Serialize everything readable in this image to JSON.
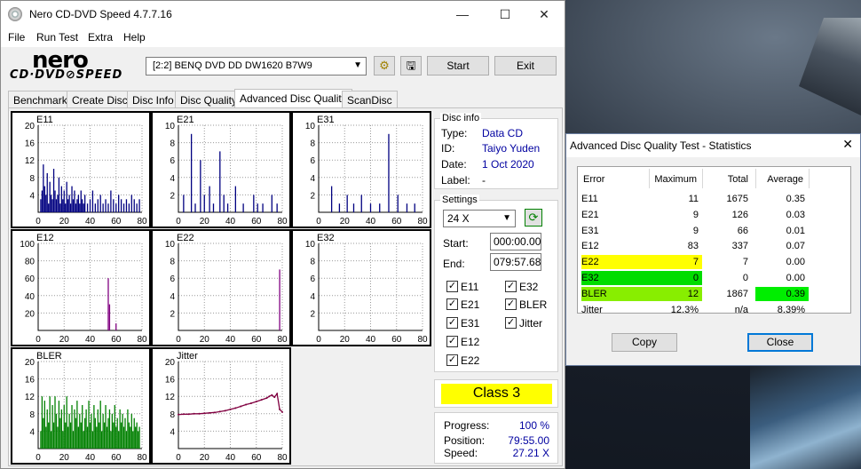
{
  "window": {
    "title": "Nero CD-DVD Speed 4.7.7.16",
    "minimize": "—",
    "maximize": "☐",
    "close": "✕"
  },
  "menu": [
    "File",
    "Run Test",
    "Extra",
    "Help"
  ],
  "logo": {
    "top": "nero",
    "bottom": "CD·DVD⊘SPEED"
  },
  "toolbar": {
    "drive": "[2:2]   BENQ DVD DD DW1620 B7W9",
    "start": "Start",
    "exit": "Exit"
  },
  "tabs": [
    "Benchmark",
    "Create Disc",
    "Disc Info",
    "Disc Quality",
    "Advanced Disc Quality",
    "ScanDisc"
  ],
  "active_tab": "Advanced Disc Quality",
  "disc_info": {
    "title": "Disc info",
    "type_label": "Type:",
    "type": "Data CD",
    "id_label": "ID:",
    "id": "Taiyo Yuden",
    "date_label": "Date:",
    "date": "1 Oct 2020",
    "label_label": "Label:",
    "label": "-"
  },
  "settings": {
    "title": "Settings",
    "speed": "24 X",
    "start_label": "Start:",
    "start": "000:00.00",
    "end_label": "End:",
    "end": "079:57.68",
    "checks": [
      {
        "label": "E11",
        "checked": true
      },
      {
        "label": "E32",
        "checked": true
      },
      {
        "label": "E21",
        "checked": true
      },
      {
        "label": "BLER",
        "checked": true
      },
      {
        "label": "E31",
        "checked": true
      },
      {
        "label": "Jitter",
        "checked": true
      },
      {
        "label": "E12",
        "checked": true
      },
      {
        "label": "E22",
        "checked": true
      }
    ]
  },
  "class": "Class 3",
  "progress": {
    "progress_label": "Progress:",
    "progress": "100 %",
    "position_label": "Position:",
    "position": "79:55.00",
    "speed_label": "Speed:",
    "speed": "27.21 X"
  },
  "chart_data": [
    {
      "type": "bar",
      "title": "E11",
      "color": "#000080",
      "ylim": [
        0,
        20
      ],
      "yticks": [
        4,
        8,
        12,
        16,
        20
      ],
      "xticks": [
        0,
        20,
        40,
        60,
        80
      ],
      "x": [
        2,
        3,
        4,
        5,
        6,
        7,
        8,
        9,
        10,
        11,
        12,
        13,
        14,
        15,
        16,
        17,
        18,
        19,
        20,
        21,
        22,
        23,
        24,
        25,
        26,
        27,
        28,
        29,
        30,
        31,
        32,
        33,
        34,
        35,
        36,
        38,
        40,
        42,
        44,
        46,
        48,
        50,
        52,
        54,
        56,
        58,
        60,
        62,
        64,
        66,
        68,
        70,
        72,
        74,
        76,
        78
      ],
      "values": [
        3,
        5,
        11,
        6,
        4,
        9,
        2,
        7,
        4,
        3,
        10,
        5,
        3,
        4,
        8,
        2,
        6,
        3,
        5,
        2,
        7,
        3,
        4,
        2,
        6,
        3,
        5,
        2,
        3,
        4,
        2,
        5,
        3,
        2,
        4,
        2,
        3,
        5,
        2,
        3,
        4,
        2,
        3,
        2,
        5,
        3,
        2,
        4,
        3,
        2,
        3,
        2,
        4,
        3,
        2,
        3
      ]
    },
    {
      "type": "bar",
      "title": "E21",
      "color": "#000080",
      "ylim": [
        0,
        10
      ],
      "yticks": [
        2,
        4,
        6,
        8,
        10
      ],
      "xticks": [
        0,
        20,
        40,
        60,
        80
      ],
      "x": [
        4,
        10,
        13,
        17,
        20,
        24,
        27,
        32,
        35,
        38,
        44,
        50,
        58,
        61,
        65,
        72,
        76
      ],
      "values": [
        2,
        9,
        1,
        6,
        2,
        3,
        1,
        7,
        2,
        1,
        3,
        1,
        2,
        1,
        1,
        2,
        1
      ]
    },
    {
      "type": "bar",
      "title": "E31",
      "color": "#000080",
      "ylim": [
        0,
        10
      ],
      "yticks": [
        2,
        4,
        6,
        8,
        10
      ],
      "xticks": [
        0,
        20,
        40,
        60,
        80
      ],
      "x": [
        10,
        16,
        22,
        27,
        33,
        40,
        47,
        54,
        61,
        68,
        74
      ],
      "values": [
        3,
        1,
        2,
        1,
        2,
        1,
        1,
        9,
        2,
        1,
        1
      ]
    },
    {
      "type": "bar",
      "title": "E12",
      "color": "#800080",
      "ylim": [
        0,
        100
      ],
      "yticks": [
        20,
        40,
        60,
        80,
        100
      ],
      "xticks": [
        0,
        20,
        40,
        60,
        80
      ],
      "x": [
        54,
        55,
        60
      ],
      "values": [
        60,
        30,
        8
      ]
    },
    {
      "type": "bar",
      "title": "E22",
      "color": "#800080",
      "ylim": [
        0,
        10
      ],
      "yticks": [
        2,
        4,
        6,
        8,
        10
      ],
      "xticks": [
        0,
        20,
        40,
        60,
        80
      ],
      "x": [
        78
      ],
      "values": [
        7
      ]
    },
    {
      "type": "bar",
      "title": "E32",
      "color": "#800080",
      "ylim": [
        0,
        10
      ],
      "yticks": [
        2,
        4,
        6,
        8,
        10
      ],
      "xticks": [
        0,
        20,
        40,
        60,
        80
      ],
      "x": [],
      "values": []
    },
    {
      "type": "bar",
      "title": "BLER",
      "color": "#008000",
      "ylim": [
        0,
        20
      ],
      "yticks": [
        4,
        8,
        12,
        16,
        20
      ],
      "xticks": [
        0,
        20,
        40,
        60,
        80
      ],
      "x": [
        2,
        3,
        4,
        5,
        6,
        7,
        8,
        9,
        10,
        11,
        12,
        13,
        14,
        15,
        16,
        17,
        18,
        19,
        20,
        21,
        22,
        23,
        24,
        25,
        26,
        27,
        28,
        29,
        30,
        31,
        32,
        33,
        34,
        35,
        36,
        37,
        38,
        39,
        40,
        41,
        42,
        43,
        44,
        45,
        46,
        47,
        48,
        49,
        50,
        51,
        52,
        53,
        54,
        55,
        56,
        57,
        58,
        59,
        60,
        61,
        62,
        63,
        64,
        65,
        66,
        67,
        68,
        69,
        70,
        71,
        72,
        73,
        74,
        75,
        76,
        77,
        78
      ],
      "values": [
        4,
        12,
        7,
        11,
        5,
        9,
        6,
        12,
        4,
        10,
        6,
        12,
        8,
        5,
        11,
        7,
        9,
        4,
        10,
        6,
        12,
        5,
        8,
        6,
        10,
        4,
        9,
        7,
        11,
        5,
        8,
        6,
        10,
        4,
        7,
        9,
        5,
        11,
        6,
        8,
        4,
        10,
        7,
        5,
        9,
        6,
        11,
        4,
        8,
        6,
        10,
        5,
        7,
        9,
        4,
        8,
        6,
        10,
        5,
        7,
        4,
        9,
        6,
        8,
        5,
        7,
        4,
        9,
        6,
        5,
        8,
        4,
        7,
        5,
        6,
        4,
        5
      ]
    },
    {
      "type": "line",
      "title": "Jitter",
      "color": "#800040",
      "ylim": [
        0,
        20
      ],
      "yticks": [
        4,
        8,
        12,
        16,
        20
      ],
      "xticks": [
        0,
        20,
        40,
        60,
        80
      ],
      "x": [
        0,
        4,
        8,
        12,
        16,
        20,
        24,
        28,
        32,
        36,
        40,
        44,
        48,
        52,
        56,
        60,
        64,
        68,
        70,
        72,
        74,
        76,
        78,
        80
      ],
      "values": [
        7.8,
        7.9,
        7.9,
        8.0,
        8.0,
        8.1,
        8.2,
        8.3,
        8.5,
        8.7,
        9.0,
        9.3,
        9.7,
        10.1,
        10.4,
        10.8,
        11.2,
        11.6,
        12.0,
        12.3,
        11.8,
        12.6,
        9.0,
        8.4
      ]
    }
  ],
  "stats_dialog": {
    "title": "Advanced Disc Quality Test - Statistics",
    "close": "✕",
    "headers": [
      "Error",
      "Maximum",
      "Total",
      "Average"
    ],
    "rows": [
      {
        "name": "E11",
        "max": "11",
        "total": "1675",
        "avg": "0.35",
        "hl": ""
      },
      {
        "name": "E21",
        "max": "9",
        "total": "126",
        "avg": "0.03",
        "hl": ""
      },
      {
        "name": "E31",
        "max": "9",
        "total": "66",
        "avg": "0.01",
        "hl": ""
      },
      {
        "name": "E12",
        "max": "83",
        "total": "337",
        "avg": "0.07",
        "hl": ""
      },
      {
        "name": "E22",
        "max": "7",
        "total": "7",
        "avg": "0.00",
        "hl": "#ffff00"
      },
      {
        "name": "E32",
        "max": "0",
        "total": "0",
        "avg": "0.00",
        "hl": "#00dd00"
      },
      {
        "name": "BLER",
        "max": "12",
        "total": "1867",
        "avg": "0.39",
        "hl": "#88ee00",
        "avg_hl": "#00ee00"
      },
      {
        "name": "Jitter",
        "max": "12.3%",
        "total": "n/a",
        "avg": "8.39%",
        "hl": ""
      }
    ],
    "copy": "Copy",
    "close_btn": "Close"
  }
}
